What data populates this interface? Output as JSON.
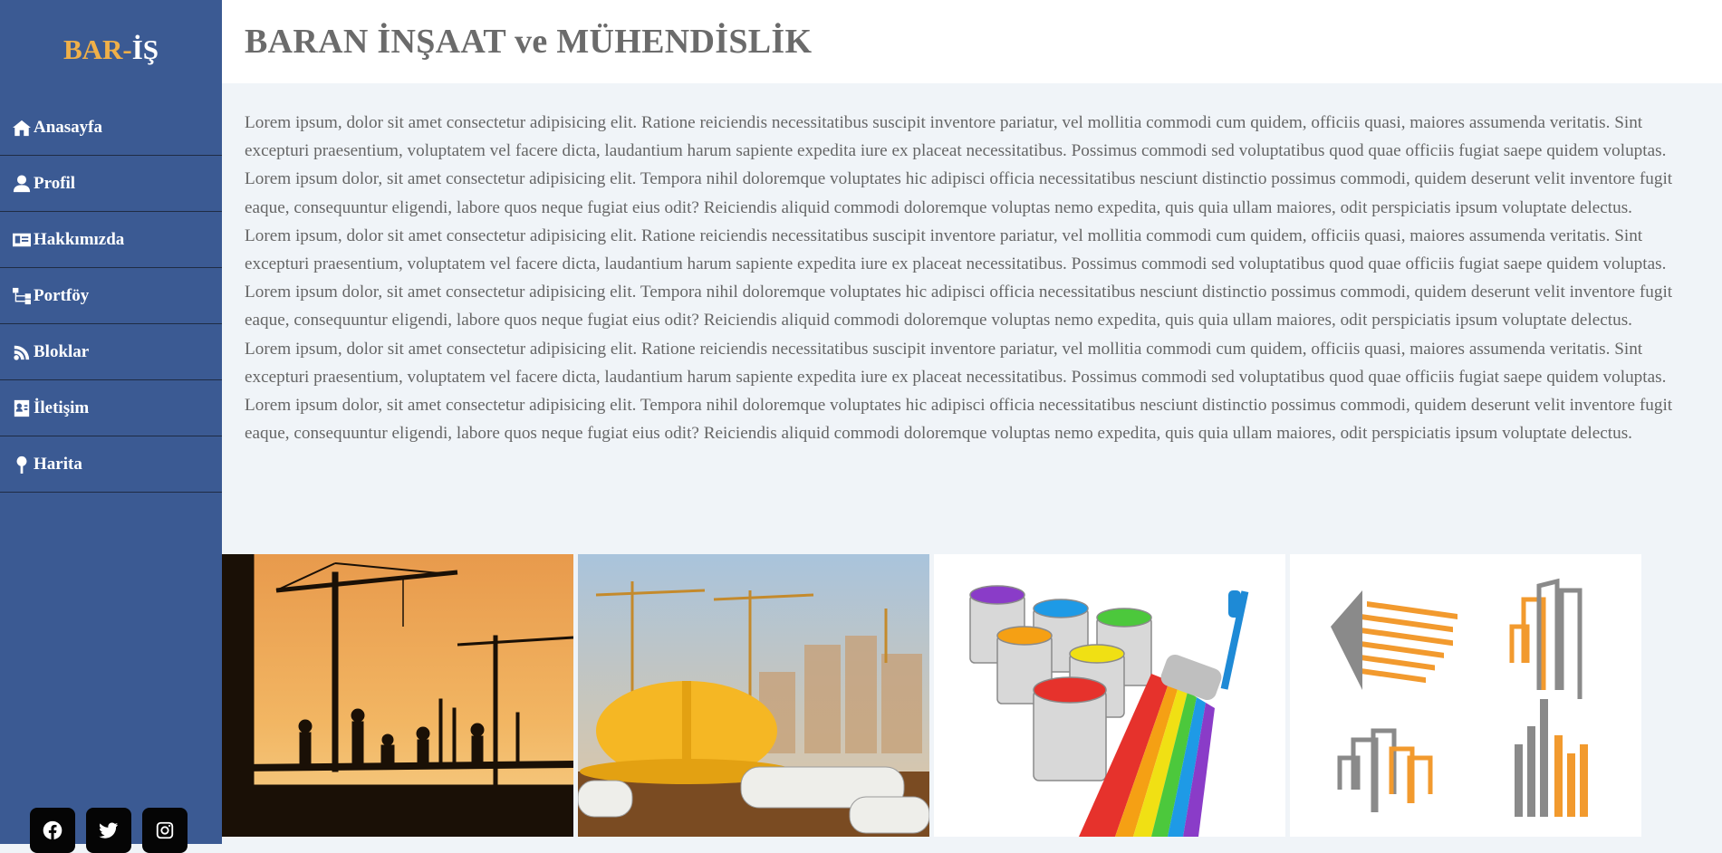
{
  "logo": {
    "part1": "BAR-",
    "part2": "İŞ"
  },
  "header": {
    "title": "BARAN İNŞAAT ve MÜHENDİSLİK"
  },
  "nav": [
    {
      "label": "Anasayfa",
      "icon": "home-icon"
    },
    {
      "label": "Profil",
      "icon": "user-icon"
    },
    {
      "label": "Hakkımızda",
      "icon": "id-card-icon"
    },
    {
      "label": "Portföy",
      "icon": "sitemap-icon"
    },
    {
      "label": "Bloklar",
      "icon": "blog-icon"
    },
    {
      "label": "İletişim",
      "icon": "contact-card-icon"
    },
    {
      "label": "Harita",
      "icon": "map-pin-icon"
    }
  ],
  "content": {
    "paragraphs": [
      "Lorem ipsum, dolor sit amet consectetur adipisicing elit. Ratione reiciendis necessitatibus suscipit inventore pariatur, vel mollitia commodi cum quidem, officiis quasi, maiores assumenda veritatis. Sint excepturi praesentium, voluptatem vel facere dicta, laudantium harum sapiente expedita iure ex placeat necessitatibus. Possimus commodi sed voluptatibus quod quae officiis fugiat saepe quidem voluptas. Lorem ipsum dolor, sit amet consectetur adipisicing elit. Tempora nihil doloremque voluptates hic adipisci officia necessitatibus nesciunt distinctio possimus commodi, quidem deserunt velit inventore fugit eaque, consequuntur eligendi, labore quos neque fugiat eius odit? Reiciendis aliquid commodi doloremque voluptas nemo expedita, quis quia ullam maiores, odit perspiciatis ipsum voluptate delectus.",
      "Lorem ipsum, dolor sit amet consectetur adipisicing elit. Ratione reiciendis necessitatibus suscipit inventore pariatur, vel mollitia commodi cum quidem, officiis quasi, maiores assumenda veritatis. Sint excepturi praesentium, voluptatem vel facere dicta, laudantium harum sapiente expedita iure ex placeat necessitatibus. Possimus commodi sed voluptatibus quod quae officiis fugiat saepe quidem voluptas. Lorem ipsum dolor, sit amet consectetur adipisicing elit. Tempora nihil doloremque voluptates hic adipisci officia necessitatibus nesciunt distinctio possimus commodi, quidem deserunt velit inventore fugit eaque, consequuntur eligendi, labore quos neque fugiat eius odit? Reiciendis aliquid commodi doloremque voluptas nemo expedita, quis quia ullam maiores, odit perspiciatis ipsum voluptate delectus.",
      "Lorem ipsum, dolor sit amet consectetur adipisicing elit. Ratione reiciendis necessitatibus suscipit inventore pariatur, vel mollitia commodi cum quidem, officiis quasi, maiores assumenda veritatis. Sint excepturi praesentium, voluptatem vel facere dicta, laudantium harum sapiente expedita iure ex placeat necessitatibus. Possimus commodi sed voluptatibus quod quae officiis fugiat saepe quidem voluptas. Lorem ipsum dolor, sit amet consectetur adipisicing elit. Tempora nihil doloremque voluptates hic adipisci officia necessitatibus nesciunt distinctio possimus commodi, quidem deserunt velit inventore fugit eaque, consequuntur eligendi, labore quos neque fugiat eius odit? Reiciendis aliquid commodi doloremque voluptas nemo expedita, quis quia ullam maiores, odit perspiciatis ipsum voluptate delectus."
    ]
  },
  "gallery": [
    {
      "icon": "construction-silhouette-image"
    },
    {
      "icon": "hard-hat-blueprints-image"
    },
    {
      "icon": "paint-cans-roller-image"
    },
    {
      "icon": "building-logos-image"
    }
  ],
  "social": [
    {
      "icon": "facebook-icon"
    },
    {
      "icon": "twitter-icon"
    },
    {
      "icon": "instagram-icon"
    }
  ],
  "colors": {
    "sidebar": "#3b5a93",
    "logo_accent": "#f0b048",
    "background": "#f0f4f8",
    "title": "#6b6b6b"
  }
}
